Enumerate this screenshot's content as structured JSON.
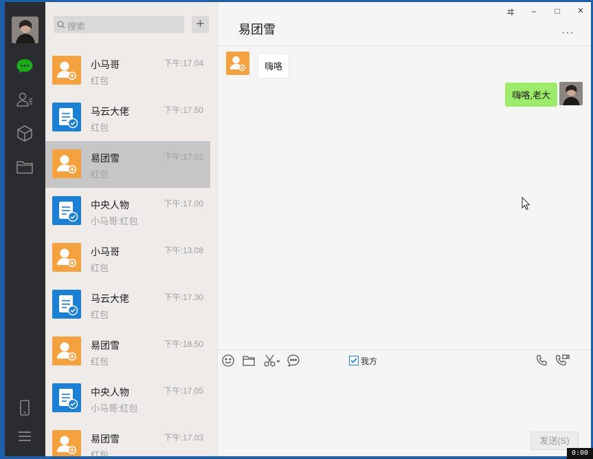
{
  "search": {
    "placeholder": "搜索"
  },
  "add_button": "+",
  "conversations": [
    {
      "name": "小马哥",
      "time": "下午:17.04",
      "sub": "红包",
      "icon": "user-add-icon",
      "color": "#f4a13f"
    },
    {
      "name": "马云大佬",
      "time": "下午:17.50",
      "sub": "红包",
      "icon": "document-check-icon",
      "color": "#1b7fd3"
    },
    {
      "name": "易团雪",
      "time": "下午:17.02",
      "sub": "红包",
      "icon": "user-add-icon",
      "color": "#f4a13f",
      "selected": true
    },
    {
      "name": "中央人物",
      "time": "下午:17.00",
      "sub": "小马哥:红包",
      "icon": "document-check-icon",
      "color": "#1b7fd3"
    },
    {
      "name": "小马哥",
      "time": "下午:13.08",
      "sub": "红包",
      "icon": "user-add-icon",
      "color": "#f4a13f"
    },
    {
      "name": "马云大佬",
      "time": "下午:17.30",
      "sub": "红包",
      "icon": "document-check-icon",
      "color": "#1b7fd3"
    },
    {
      "name": "易团雪",
      "time": "下午:18.50",
      "sub": "红包",
      "icon": "user-add-icon",
      "color": "#f4a13f"
    },
    {
      "name": "中央人物",
      "time": "下午:17.05",
      "sub": "小马哥:红包",
      "icon": "document-check-icon",
      "color": "#1b7fd3"
    },
    {
      "name": "易团雪",
      "time": "下午:17.03",
      "sub": "红包",
      "icon": "user-add-icon",
      "color": "#f4a13f"
    }
  ],
  "chat": {
    "title": "易团雪",
    "more": "···",
    "messages": [
      {
        "direction": "in",
        "text": "嗨咯"
      },
      {
        "direction": "out",
        "text": "嗨咯,老大"
      }
    ],
    "self_checkbox": {
      "label": "我方",
      "checked": true
    },
    "send_label": "发送(S)"
  },
  "window_controls": {
    "pin": "ヰ",
    "minimize": "–",
    "maximize": "□",
    "close": "×"
  },
  "overlay_badge": "0:00",
  "colors": {
    "nav_bg": "#2a2c30",
    "list_bg": "#eeebe8",
    "selected_bg": "#c6c6c6",
    "accent_green": "#1aad19",
    "bubble_out": "#9eea6a"
  }
}
